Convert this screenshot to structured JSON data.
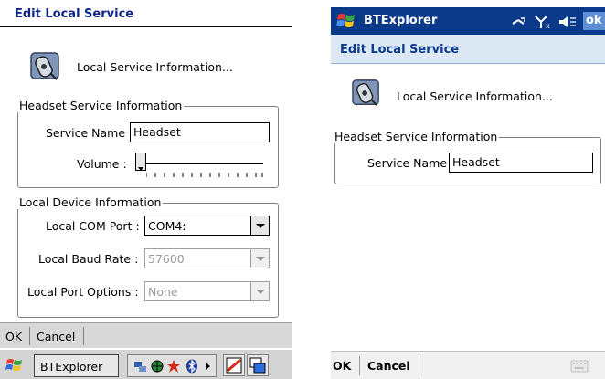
{
  "left_screen": {
    "title": "Edit Local Service",
    "header_text": "Local Service Information...",
    "headset_group": {
      "legend": "Headset Service Information",
      "service_name_label": "Service Name",
      "service_name_value": "Headset",
      "volume_label": "Volume :",
      "volume_level": 0
    },
    "device_group": {
      "legend": "Local Device Information",
      "com_port_label": "Local COM Port :",
      "com_port_value": "COM4:",
      "baud_rate_label": "Local Baud Rate :",
      "baud_rate_value": "57600",
      "port_options_label": "Local Port Options :",
      "port_options_value": "None"
    },
    "menu": {
      "ok": "OK",
      "cancel": "Cancel"
    },
    "taskbar": {
      "app_button": "BTExplorer"
    }
  },
  "right_screen": {
    "status_bar": {
      "app_name": "BTExplorer",
      "ok": "ok"
    },
    "title": "Edit Local Service",
    "header_text": "Local Service Information...",
    "headset_group": {
      "legend": "Headset Service Information",
      "service_name_label": "Service Name",
      "service_name_value": "Headset"
    },
    "menu": {
      "ok": "OK",
      "cancel": "Cancel"
    }
  },
  "colors": {
    "title_text": "#10248a",
    "status_bar_bg": "#0b3a8a",
    "subtitle_bg": "#dce8f4"
  },
  "icons": [
    "bluetooth-device-icon",
    "windows-start-flag-icon",
    "connectivity-icon",
    "signal-off-icon",
    "speaker-icon",
    "keyboard-icon"
  ]
}
